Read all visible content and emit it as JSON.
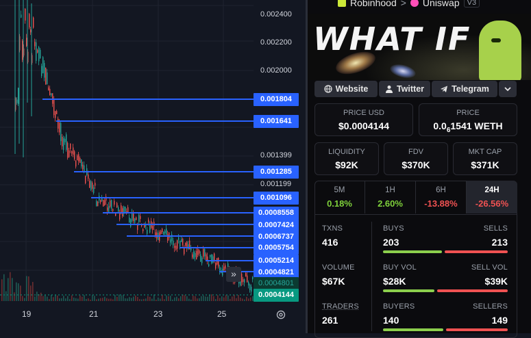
{
  "header": {
    "chain": "Robinhood",
    "sep": ">",
    "dex": "Uniswap",
    "version": "V3"
  },
  "banner": {
    "text": "WHAT IF"
  },
  "links": {
    "website": "Website",
    "twitter": "Twitter",
    "telegram": "Telegram"
  },
  "price_usd": {
    "label": "PRICE USD",
    "value": "$0.0004144"
  },
  "price_native": {
    "label": "PRICE",
    "prefix": "0.0",
    "sub": "6",
    "rest": "1541 WETH"
  },
  "liquidity": {
    "label": "LIQUIDITY",
    "value": "$92K"
  },
  "fdv": {
    "label": "FDV",
    "value": "$370K"
  },
  "mktcap": {
    "label": "MKT CAP",
    "value": "$371K"
  },
  "timeframes": [
    {
      "label": "5M",
      "value": "0.18%",
      "color": "#7fd13b"
    },
    {
      "label": "1H",
      "value": "2.60%",
      "color": "#7fd13b"
    },
    {
      "label": "6H",
      "value": "-13.88%",
      "color": "#f05252"
    },
    {
      "label": "24H",
      "value": "-26.56%",
      "color": "#f05252"
    }
  ],
  "stats": {
    "txns_label": "TXNS",
    "txns": "416",
    "buys_label": "BUYS",
    "buys": "203",
    "sells_label": "SELLS",
    "sells": "213",
    "volume_label": "VOLUME",
    "volume": "$67K",
    "buyvol_label": "BUY VOL",
    "buyvol": "$28K",
    "sellvol_label": "SELL VOL",
    "sellvol": "$39K",
    "traders_label": "TRADERS",
    "traders": "261",
    "buyers_label": "BUYERS",
    "buyers": "140",
    "sellers_label": "SELLERS",
    "sellers": "149"
  },
  "chart": {
    "y_labels": [
      "0.002400",
      "0.002200",
      "0.002000",
      "0.001399",
      "0.001199"
    ],
    "hlines": [
      "0.001804",
      "0.001641",
      "0.001285",
      "0.001096",
      "0.0008558",
      "0.0007424",
      "0.0006737",
      "0.0005754",
      "0.0005214",
      "0.0004821"
    ],
    "last_price_dark": "0.0004801",
    "last_price": "0.0004144",
    "x_labels": [
      "19",
      "21",
      "23",
      "25"
    ],
    "colors": {
      "up": "#26a69a",
      "down": "#ef5350",
      "line": "#2962ff",
      "price": "#089981"
    }
  }
}
